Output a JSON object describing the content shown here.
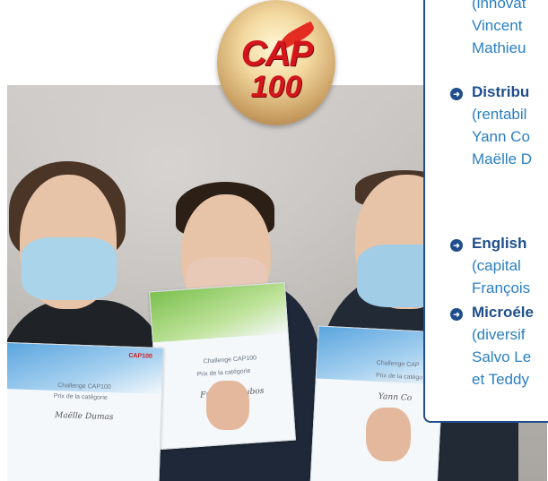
{
  "logo": {
    "line1": "CAP",
    "line2": "100"
  },
  "panel": {
    "lines_top": [
      "(innovat",
      "Vincent",
      "Mathieu"
    ],
    "items": [
      {
        "title": "Distribu",
        "lines": [
          "(rentabil",
          "Yann Co",
          "Maëlle D"
        ]
      },
      {
        "title": "English",
        "lines": [
          "(capital",
          "François"
        ]
      },
      {
        "title": "Microéle",
        "lines": [
          "(diversif",
          "Salvo Le",
          "et Teddy"
        ]
      }
    ]
  },
  "certificates": {
    "left": {
      "brand": "CAP100",
      "heading": "Challenge CAP100",
      "prize": "Prix de la catégorie",
      "name": "Maëlle Dumas"
    },
    "middle": {
      "heading": "Challenge CAP100",
      "prize": "Prix de la catégorie",
      "name": "François Dubos"
    },
    "right": {
      "heading": "Challenge CAP",
      "prize": "Prix de la catégo",
      "name": "Yann Co"
    }
  },
  "colors": {
    "accent": "#1f4e8c",
    "link": "#2a7fc1",
    "logo_red": "#d4161c"
  }
}
